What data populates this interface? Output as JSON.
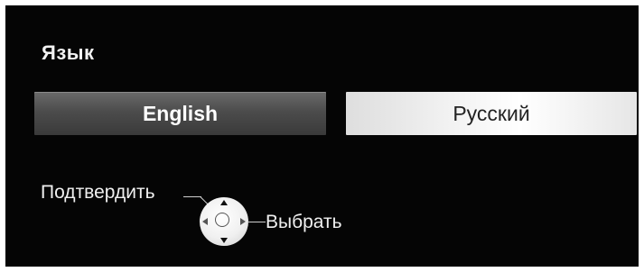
{
  "screen": {
    "title": "Язык"
  },
  "languages": {
    "options": [
      {
        "label": "English",
        "selected": true
      },
      {
        "label": "Русский",
        "selected": false
      }
    ]
  },
  "hints": {
    "confirm_label": "Подтвердить",
    "select_label": "Выбрать"
  },
  "icons": {
    "remote": "dpad-icon",
    "up": "arrow-up-icon",
    "down": "arrow-down-icon",
    "left": "arrow-left-icon",
    "right": "arrow-right-icon",
    "center": "enter-button-icon"
  }
}
